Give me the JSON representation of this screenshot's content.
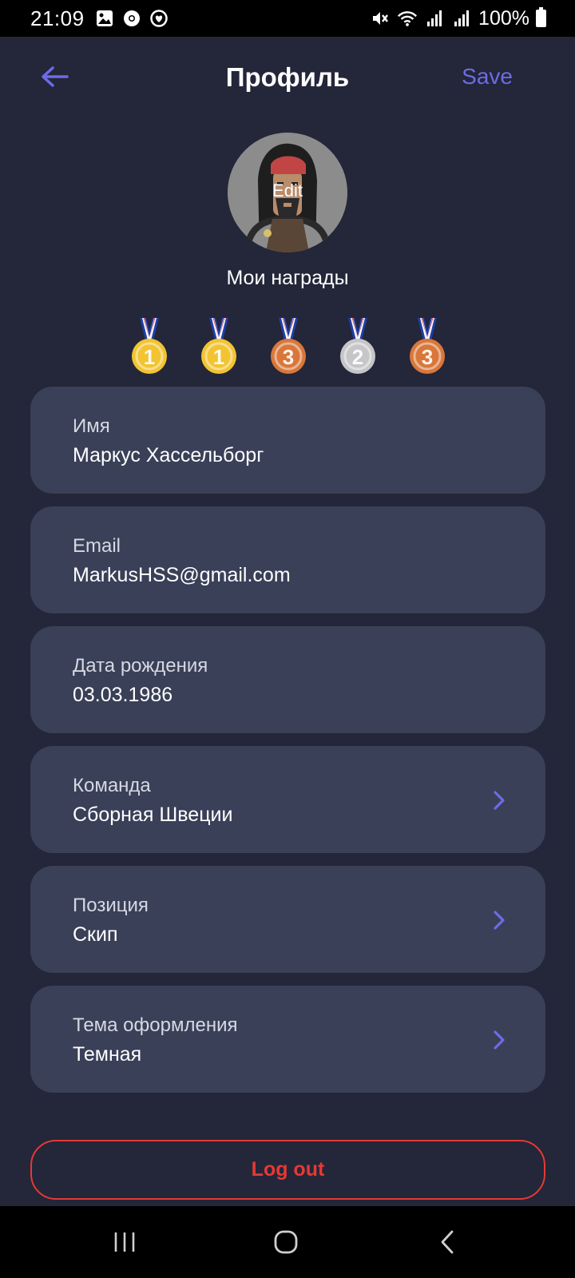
{
  "status_bar": {
    "time": "21:09",
    "battery": "100%",
    "icons": [
      "gallery-icon",
      "chrome-icon",
      "app-icon",
      "mute-icon",
      "wifi-icon",
      "signal-icon",
      "signal-icon",
      "battery-icon"
    ]
  },
  "header": {
    "back_icon": "arrow-left-icon",
    "title": "Профиль",
    "save_label": "Save"
  },
  "avatar": {
    "edit_label": "Edit"
  },
  "awards": {
    "title": "Мои награды",
    "medals": [
      {
        "place": "1",
        "color": "#F2C431"
      },
      {
        "place": "1",
        "color": "#F2C431"
      },
      {
        "place": "3",
        "color": "#D9773A"
      },
      {
        "place": "2",
        "color": "#C6C6C8"
      },
      {
        "place": "3",
        "color": "#D9773A"
      }
    ]
  },
  "fields": [
    {
      "label": "Имя",
      "value": "Маркус Хассельборг",
      "has_chevron": false
    },
    {
      "label": "Email",
      "value": "MarkusHSS@gmail.com",
      "has_chevron": false
    },
    {
      "label": "Дата рождения",
      "value": "03.03.1986",
      "has_chevron": false
    },
    {
      "label": "Команда",
      "value": "Сборная Швеции",
      "has_chevron": true
    },
    {
      "label": "Позиция",
      "value": "Скип",
      "has_chevron": true
    },
    {
      "label": "Тема оформления",
      "value": "Темная",
      "has_chevron": true
    }
  ],
  "logout_label": "Log out",
  "colors": {
    "background": "#242639",
    "card": "#394058",
    "accent": "#6D6BE6",
    "danger": "#E53935"
  },
  "nav_bar": {
    "buttons": [
      "recent-apps-icon",
      "home-icon",
      "back-icon"
    ]
  }
}
